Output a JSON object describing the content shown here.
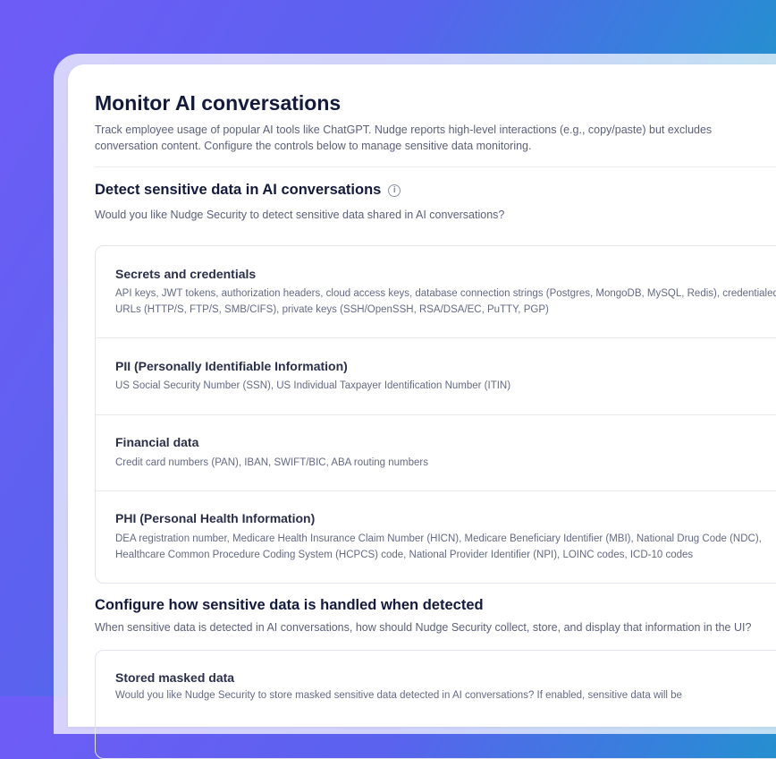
{
  "page": {
    "title": "Monitor AI conversations",
    "description": "Track employee usage of popular AI tools like ChatGPT. Nudge reports high-level interactions (e.g., copy/paste) but excludes conversation content. Configure the controls below to manage sensitive data monitoring."
  },
  "detect_section": {
    "title": "Detect sensitive data in AI conversations",
    "info_icon": "i",
    "subtitle": "Would you like Nudge Security to detect sensitive data shared in AI conversations?",
    "items": [
      {
        "title": "Secrets and credentials",
        "description": "API keys, JWT tokens, authorization headers, cloud access keys, database connection strings (Postgres, MongoDB, MySQL, Redis), credentialed URLs (HTTP/S, FTP/S, SMB/CIFS), private keys (SSH/OpenSSH, RSA/DSA/EC, PuTTY, PGP)"
      },
      {
        "title": "PII (Personally Identifiable Information)",
        "description": "US Social Security Number (SSN), US Individual Taxpayer Identification Number (ITIN)"
      },
      {
        "title": "Financial data",
        "description": "Credit card numbers (PAN), IBAN, SWIFT/BIC, ABA routing numbers"
      },
      {
        "title": "PHI (Personal Health Information)",
        "description": "DEA registration number, Medicare Health Insurance Claim Number (HICN), Medicare Beneficiary Identifier (MBI), National Drug Code (NDC), Healthcare Common Procedure Coding System (HCPCS) code, National Provider Identifier (NPI), LOINC codes, ICD-10 codes"
      }
    ]
  },
  "configure_section": {
    "title": "Configure how sensitive data is handled when detected",
    "subtitle": "When sensitive data is detected in AI conversations, how should Nudge Security collect, store, and display that information in the UI?",
    "items": [
      {
        "title": "Stored masked data",
        "description": "Would you like Nudge Security to store masked sensitive data detected in AI conversations? If enabled, sensitive data will be"
      }
    ]
  }
}
